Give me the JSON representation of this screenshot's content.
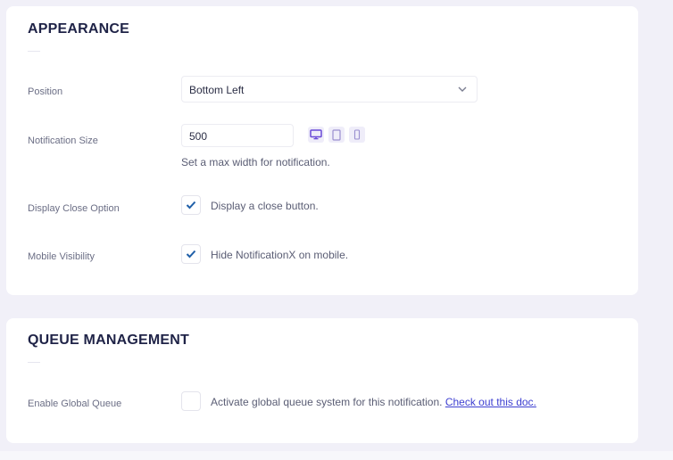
{
  "appearance": {
    "title": "APPEARANCE",
    "position": {
      "label": "Position",
      "value": "Bottom Left",
      "icon": "chevron-down-icon"
    },
    "notification_size": {
      "label": "Notification Size",
      "value": "500",
      "devices": [
        "desktop-icon",
        "tablet-icon",
        "mobile-icon"
      ],
      "help": "Set a max width for notification."
    },
    "close_option": {
      "label": "Display Close Option",
      "text": "Display a close button.",
      "checked": true
    },
    "mobile_visibility": {
      "label": "Mobile Visibility",
      "text": "Hide NotificationX on mobile.",
      "checked": true
    }
  },
  "queue": {
    "title": "QUEUE MANAGEMENT",
    "global_queue": {
      "label": "Enable Global Queue",
      "text": "Activate global queue system for this notification.",
      "link": "Check out this doc.",
      "checked": false
    }
  },
  "colors": {
    "accent": "#6a4bd8",
    "check": "#1f5fa8",
    "link": "#3d3fd1",
    "title": "#1f2347"
  }
}
